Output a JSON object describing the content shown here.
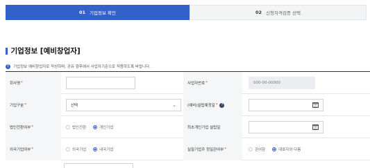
{
  "steps": [
    {
      "num": "01",
      "label": "기업정보 확인",
      "active": true
    },
    {
      "num": "02",
      "label": "신청자격검증 선택",
      "active": false
    }
  ],
  "section_title": "기업정보 [예비창업자]",
  "notice": "기업정보 예비창업자로 작성하며, 공유 향후에서 사업자기준으로 적용하도록 바랍니다.",
  "form": {
    "company_name": {
      "label": "회사명",
      "value": ""
    },
    "biz_number": {
      "label": "사업자번호",
      "value": "000-00-00000"
    },
    "company_type": {
      "label": "기업구분",
      "value": "선택"
    },
    "founding_date": {
      "label": "(예비)설립예정일",
      "value": ""
    },
    "corp_status": {
      "label": "법인전환여부",
      "options": [
        "법인전환",
        "개인기업"
      ],
      "selected": 1
    },
    "last_company_date": {
      "label": "최초개인기업 설립일",
      "value": ""
    },
    "foreign_status": {
      "label": "외국기업여부",
      "options": [
        "외국기업",
        "내국기업"
      ],
      "selected": 1
    },
    "actual_location": {
      "label": "실질기업주 정밀관여부",
      "options": [
        "관여함",
        "대표자와 다름"
      ],
      "selected": 1
    }
  },
  "colors": {
    "accent": "#3461c9",
    "required": "#e03131"
  }
}
